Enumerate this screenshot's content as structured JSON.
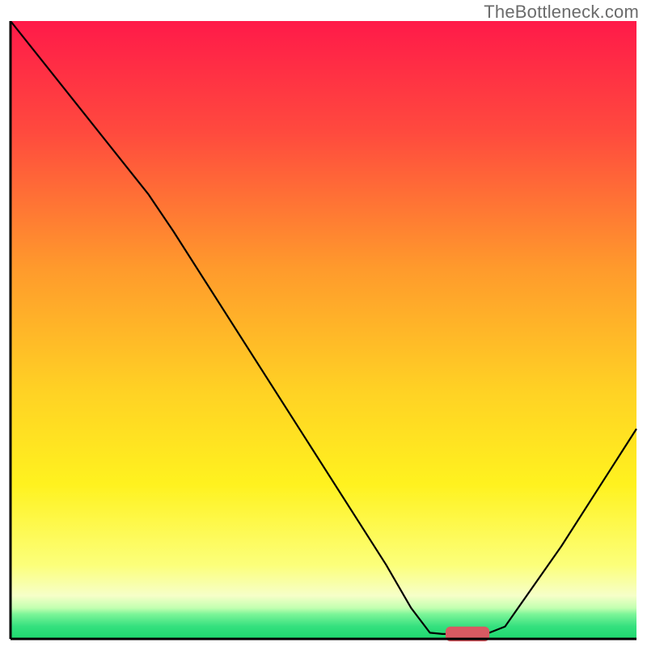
{
  "watermark": "TheBottleneck.com",
  "chart_data": {
    "type": "line",
    "title": "",
    "xlabel": "",
    "ylabel": "",
    "xlim": [
      0,
      100
    ],
    "ylim": [
      0,
      100
    ],
    "gradient_stops": [
      {
        "pct": 0,
        "color": "#ff1a49"
      },
      {
        "pct": 18,
        "color": "#ff4a3e"
      },
      {
        "pct": 40,
        "color": "#ff9a2c"
      },
      {
        "pct": 60,
        "color": "#ffd224"
      },
      {
        "pct": 75,
        "color": "#fff21f"
      },
      {
        "pct": 88,
        "color": "#fcff7a"
      },
      {
        "pct": 93,
        "color": "#f6ffc8"
      },
      {
        "pct": 95,
        "color": "#c2ffb0"
      },
      {
        "pct": 96,
        "color": "#7cf598"
      },
      {
        "pct": 98,
        "color": "#34e07e"
      },
      {
        "pct": 100,
        "color": "#1ed96e"
      }
    ],
    "curve_points": [
      {
        "x": 0,
        "y": 100
      },
      {
        "x": 22,
        "y": 72
      },
      {
        "x": 26,
        "y": 66
      },
      {
        "x": 60,
        "y": 12
      },
      {
        "x": 64,
        "y": 5
      },
      {
        "x": 67,
        "y": 1
      },
      {
        "x": 69,
        "y": 0.8
      },
      {
        "x": 76,
        "y": 0.8
      },
      {
        "x": 79,
        "y": 2
      },
      {
        "x": 88,
        "y": 15
      },
      {
        "x": 100,
        "y": 34
      }
    ],
    "marker": {
      "x": 73,
      "y": 0.8,
      "width": 7,
      "height": 2.4,
      "color": "#d85a62"
    },
    "axis_color": "#000000",
    "curve_color": "#000000",
    "curve_width": 2.2
  }
}
